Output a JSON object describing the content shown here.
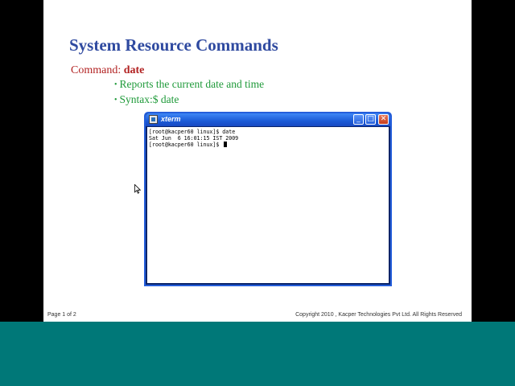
{
  "slide": {
    "title": "System Resource Commands",
    "command_prefix": "Command: ",
    "command_name": "date",
    "bullets": [
      "Reports the current date and time",
      "Syntax:$ date"
    ],
    "footer_page": "Page 1 of 2",
    "footer_copyright": "Copyright  2010 , Kacper Technologies Pvt Ltd. All Rights Reserved"
  },
  "xterm": {
    "title": "xterm",
    "lines": [
      "[root@kacper60 linux]$ date",
      "Sat Jun  6 16:01:15 IST 2009",
      "[root@kacper60 linux]$ "
    ],
    "buttons": {
      "minimize": "_",
      "maximize": "□",
      "close": "✕"
    }
  },
  "colors": {
    "title": "#2f4aa0",
    "command": "#b22222",
    "bullet": "#1f9a3a",
    "bottom_band": "#007878",
    "titlebar": "#1b5ad6"
  },
  "icons": {
    "xterm_app": "terminal-icon",
    "pointer": "mouse-pointer-icon"
  }
}
